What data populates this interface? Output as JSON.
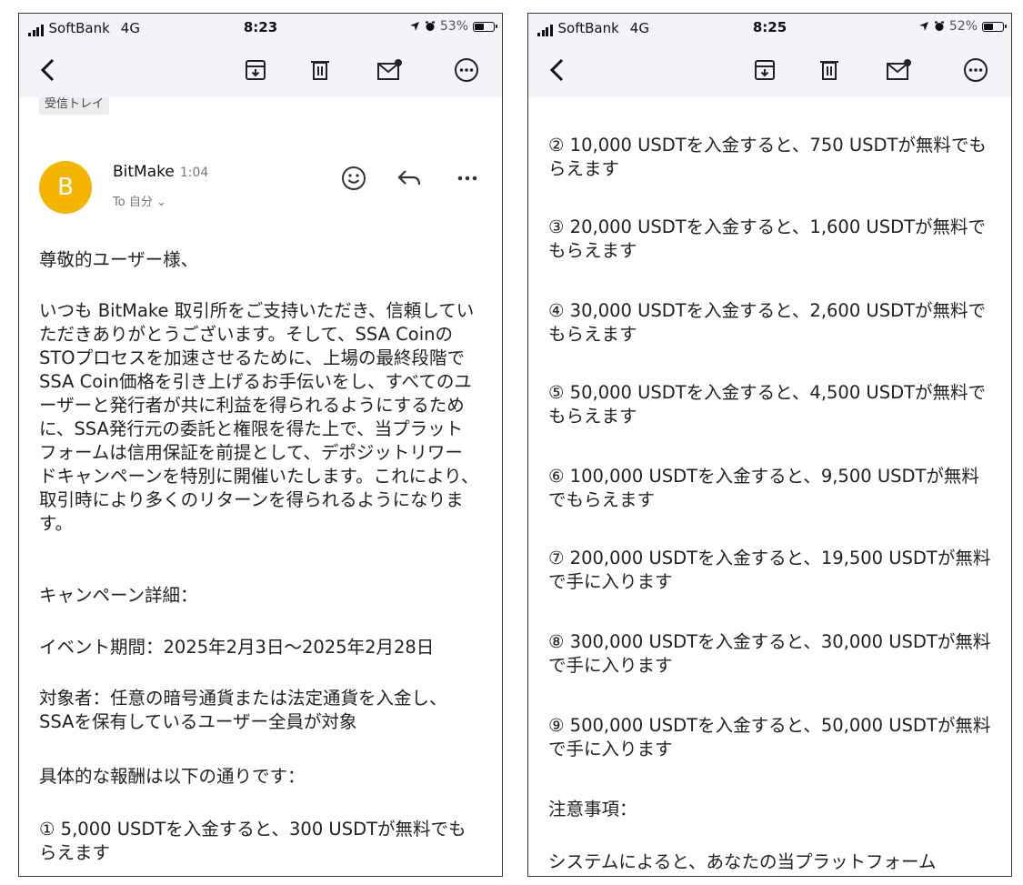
{
  "screens": [
    {
      "status": {
        "carrier": "SoftBank",
        "network": "4G",
        "time": "8:23",
        "battery": "53%",
        "battery_level": 0.53
      },
      "folder_chip": "受信トレイ",
      "email": {
        "sender_initial": "B",
        "sender": "BitMake",
        "time": "1:04",
        "to": "To 自分 ⌄"
      },
      "paragraphs": [
        "尊敬的ユーザー様、",
        "いつも BitMake 取引所をご支持いただき、信頼していただきありがとうございます。そして、SSA CoinのSTOプロセスを加速させるために、上場の最終段階でSSA Coin価格を引き上げるお手伝いをし、すべてのユーザーと発行者が共に利益を得られるようにするために、SSA発行元の委託と権限を得た上で、当プラットフォームは信用保証を前提として、デポジットリワードキャンペーンを特別に開催いたします。これにより、取引時により多くのリターンを得られるようになります。",
        "キャンペーン詳細：",
        "イベント期間：2025年2月3日〜2025年2月28日",
        "対象者：任意の暗号通貨または法定通貨を入金し、SSAを保有しているユーザー全員が対象",
        "具体的な報酬は以下の通りです：",
        "① 5,000 USDTを入金すると、300 USDTが無料でもらえます"
      ]
    },
    {
      "status": {
        "carrier": "SoftBank",
        "network": "4G",
        "time": "8:25",
        "battery": "52%",
        "battery_level": 0.52
      },
      "paragraphs": [
        "② 10,000 USDTを入金すると、750 USDTが無料でもらえます",
        "③ 20,000 USDTを入金すると、1,600 USDTが無料でもらえます",
        "④ 30,000 USDTを入金すると、2,600 USDTが無料でもらえます",
        "⑤ 50,000 USDTを入金すると、4,500 USDTが無料でもらえます",
        "⑥ 100,000 USDTを入金すると、9,500 USDTが無料でもらえます",
        "⑦ 200,000 USDTを入金すると、19,500 USDTが無料で手に入ります",
        "⑧ 300,000 USDTを入金すると、30,000 USDTが無料で手に入ります",
        "⑨ 500,000 USDTを入金すると、50,000 USDTが無料で手に入ります",
        "注意事項：",
        "システムによると、あなたの当プラットフォーム"
      ]
    }
  ],
  "toolbar_icons": [
    "back-icon",
    "archive-icon",
    "trash-icon",
    "mark-unread-icon",
    "more-icon"
  ],
  "colors": {
    "avatar": "#f5b400",
    "toolbar_bg": "#f3f4f8"
  }
}
